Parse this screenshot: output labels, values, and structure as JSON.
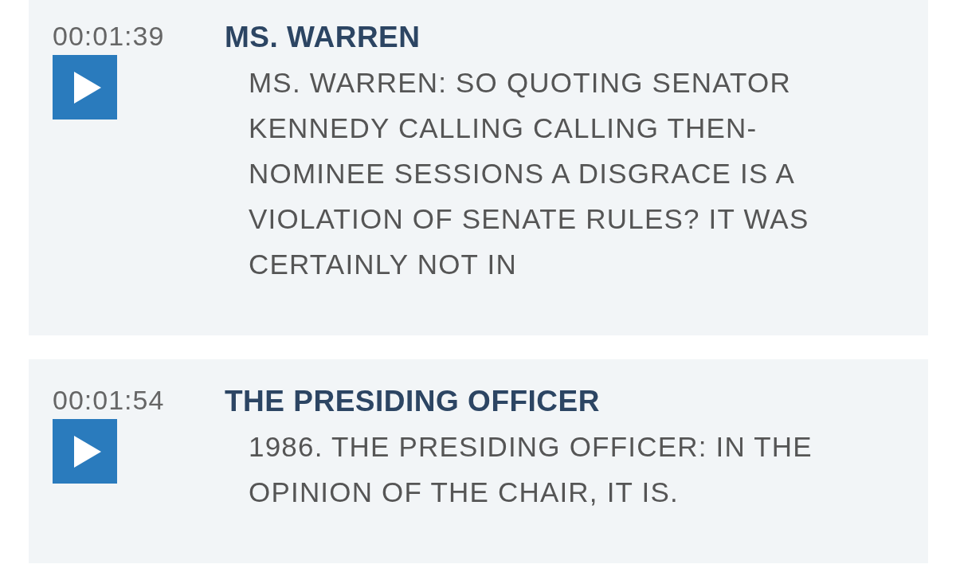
{
  "entries": [
    {
      "timestamp": "00:01:39",
      "speaker": "MS. WARREN",
      "transcript": "MS. WARREN: SO QUOTING SENATOR KENNEDY CALLING CALLING THEN-NOMINEE SESSIONS A DISGRACE IS A VIOLATION OF SENATE RULES? IT WAS CERTAINLY NOT IN"
    },
    {
      "timestamp": "00:01:54",
      "speaker": "THE PRESIDING OFFICER",
      "transcript": "1986. THE PRESIDING OFFICER: IN THE OPINION OF THE CHAIR, IT IS."
    }
  ]
}
